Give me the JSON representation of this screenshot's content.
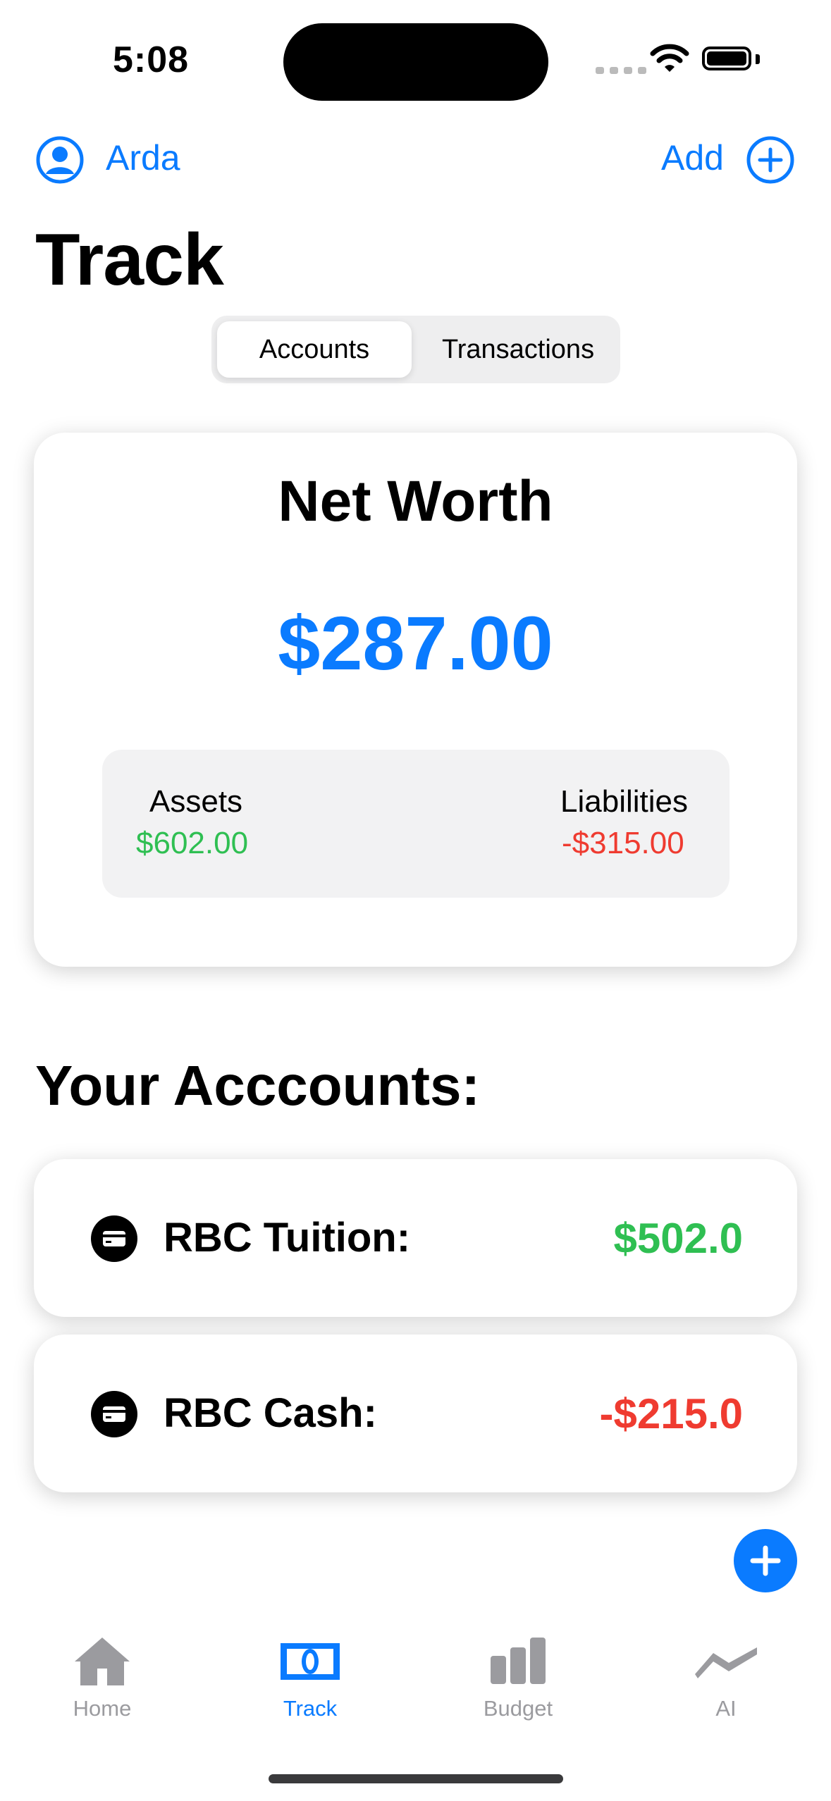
{
  "status_bar": {
    "time": "5:08"
  },
  "nav": {
    "profile_name": "Arda",
    "add_label": "Add"
  },
  "page_title": "Track",
  "segmented": {
    "tabs": [
      "Accounts",
      "Transactions"
    ],
    "selected": "Accounts"
  },
  "net_worth": {
    "title": "Net Worth",
    "value": "$287.00",
    "assets_label": "Assets",
    "assets_value": "$602.00",
    "liabilities_label": "Liabilities",
    "liabilities_value": "-$315.00"
  },
  "accounts_section": {
    "title": "Your Acccounts:",
    "items": [
      {
        "name": "RBC Tuition:",
        "value": "$502.0",
        "color": "#2fbf52"
      },
      {
        "name": "RBC Cash:",
        "value": "-$215.0",
        "color": "#ef3b30"
      }
    ]
  },
  "tab_bar": {
    "items": [
      {
        "label": "Home",
        "icon": "house-icon"
      },
      {
        "label": "Track",
        "icon": "banknote-icon"
      },
      {
        "label": "Budget",
        "icon": "bar-chart-icon"
      },
      {
        "label": "AI",
        "icon": "trend-line-icon"
      }
    ],
    "active": "Track"
  },
  "colors": {
    "accent": "#0a7bff",
    "positive": "#2fbf52",
    "negative": "#ef3b30"
  }
}
